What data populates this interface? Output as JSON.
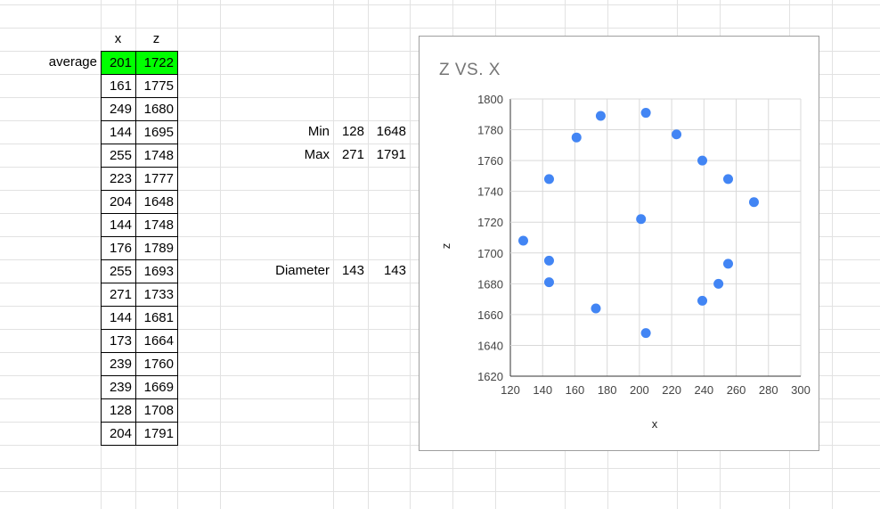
{
  "sheet": {
    "headers": {
      "x": "x",
      "z": "z"
    },
    "average": {
      "label": "average",
      "x": "201",
      "z": "1722"
    },
    "rows": [
      {
        "x": "161",
        "z": "1775"
      },
      {
        "x": "249",
        "z": "1680"
      },
      {
        "x": "144",
        "z": "1695"
      },
      {
        "x": "255",
        "z": "1748"
      },
      {
        "x": "223",
        "z": "1777"
      },
      {
        "x": "204",
        "z": "1648"
      },
      {
        "x": "144",
        "z": "1748"
      },
      {
        "x": "176",
        "z": "1789"
      },
      {
        "x": "255",
        "z": "1693"
      },
      {
        "x": "271",
        "z": "1733"
      },
      {
        "x": "144",
        "z": "1681"
      },
      {
        "x": "173",
        "z": "1664"
      },
      {
        "x": "239",
        "z": "1760"
      },
      {
        "x": "239",
        "z": "1669"
      },
      {
        "x": "128",
        "z": "1708"
      },
      {
        "x": "204",
        "z": "1791"
      }
    ],
    "min": {
      "label": "Min",
      "x": "128",
      "z": "1648"
    },
    "max": {
      "label": "Max",
      "x": "271",
      "z": "1791"
    },
    "diameter": {
      "label": "Diameter",
      "x": "143",
      "z": "143"
    },
    "colors": {
      "average_fill": "#00ff00",
      "gridline": "#e2e2e2"
    }
  },
  "chart_data": {
    "type": "scatter",
    "title": "z vs. x",
    "xlabel": "x",
    "ylabel": "z",
    "xlim": [
      120,
      300
    ],
    "ylim": [
      1620,
      1800
    ],
    "xticks": [
      120,
      140,
      160,
      180,
      200,
      220,
      240,
      260,
      280,
      300
    ],
    "yticks": [
      1620,
      1640,
      1660,
      1680,
      1700,
      1720,
      1740,
      1760,
      1780,
      1800
    ],
    "grid": true,
    "legend": "none",
    "point_color": "#4285f4",
    "title_color": "#757575",
    "x": [
      201,
      161,
      249,
      144,
      255,
      223,
      204,
      144,
      176,
      255,
      271,
      144,
      173,
      239,
      239,
      128,
      204
    ],
    "y": [
      1722,
      1775,
      1680,
      1695,
      1748,
      1777,
      1648,
      1748,
      1789,
      1693,
      1733,
      1681,
      1664,
      1760,
      1669,
      1708,
      1791
    ]
  }
}
